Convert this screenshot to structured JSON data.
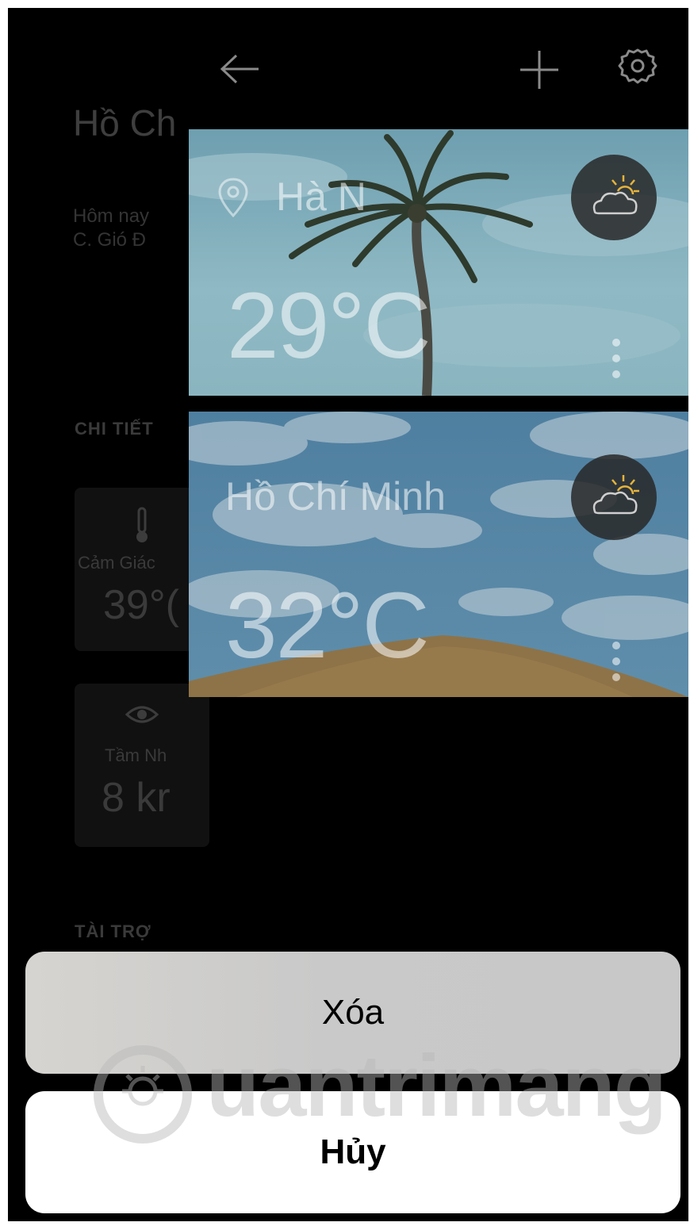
{
  "background_page": {
    "title": "Hồ Ch",
    "subtitle_line1": "Hôm nay",
    "subtitle_line2": "C. Gió Đ",
    "details_heading": "CHI TIẾT",
    "card1_label": "Cảm Giác",
    "card1_value": "39°(",
    "card2_label": "Tầm Nh",
    "card2_value": "8 kr",
    "sponsor_heading": "TÀI TRỢ"
  },
  "topbar": {
    "back_icon": "arrow-left-icon",
    "add_icon": "plus-icon",
    "settings_icon": "gear-icon"
  },
  "locations": [
    {
      "city": "Hà N",
      "temperature": "29°C",
      "weather_icon": "partly-cloudy-icon",
      "has_pin": true
    },
    {
      "city": "Hồ Chí Minh",
      "temperature": "32°C",
      "weather_icon": "partly-cloudy-icon",
      "has_pin": false
    }
  ],
  "action_sheet": {
    "delete_label": "Xóa",
    "cancel_label": "Hủy"
  },
  "watermark": {
    "text": "uantrimang"
  },
  "colors": {
    "background": "#000000",
    "sun_accent": "#e6b43a",
    "sheet_button": "#ffffff"
  }
}
